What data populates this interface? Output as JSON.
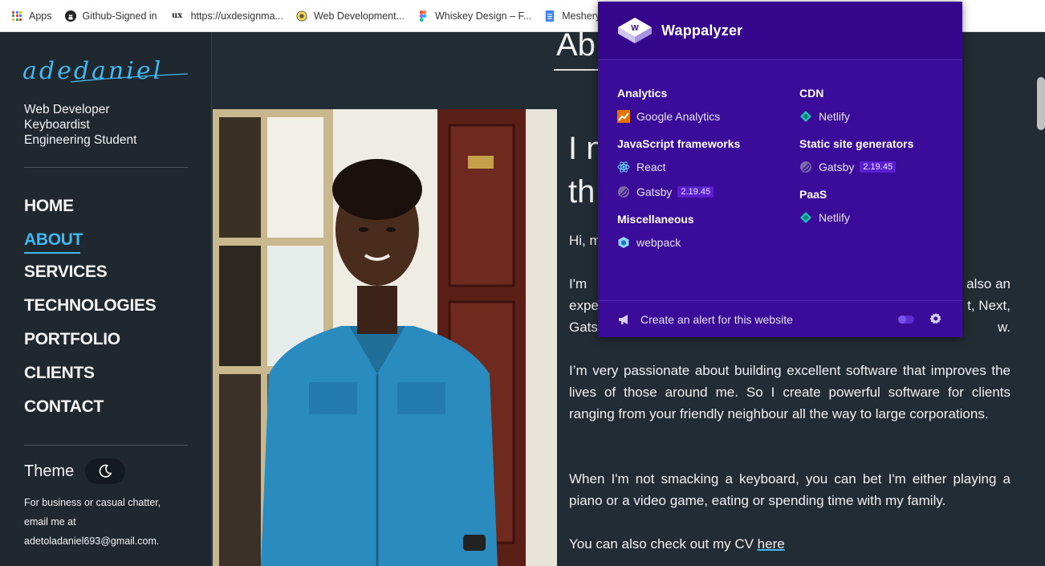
{
  "bookmarks": [
    {
      "icon": "apps-grid-icon",
      "label": "Apps"
    },
    {
      "icon": "github-icon",
      "label": "Github-Signed in"
    },
    {
      "icon": "ux-icon",
      "label": "https://uxdesignma..."
    },
    {
      "icon": "web-dev-icon",
      "label": "Web Development..."
    },
    {
      "icon": "figma-icon",
      "label": "Whiskey Design – F..."
    },
    {
      "icon": "docs-icon",
      "label": "Meshery"
    }
  ],
  "sidebar": {
    "logo_text": "adedaniel",
    "tagline": [
      "Web Developer",
      "Keyboardist",
      "Engineering Student"
    ],
    "nav": [
      {
        "label": "HOME",
        "active": false
      },
      {
        "label": "ABOUT",
        "active": true
      },
      {
        "label": "SERVICES",
        "active": false
      },
      {
        "label": "TECHNOLOGIES",
        "active": false
      },
      {
        "label": "PORTFOLIO",
        "active": false
      },
      {
        "label": "CLIENTS",
        "active": false
      },
      {
        "label": "CONTACT",
        "active": false
      }
    ],
    "theme_label": "Theme",
    "contact_text": "For business or casual chatter, email me at adetoladaniel693@gmail.com."
  },
  "main": {
    "title": "Ab",
    "heading_line1": "I n",
    "heading_line2": "th",
    "para1": "Hi, m",
    "para2_line1_start": "I'm",
    "para2_line1_end": "also an",
    "para2_line2_start": "expe",
    "para2_line2_end": "t, Next,",
    "para2_line3_start": "Gats",
    "para2_line3_end": "w.",
    "para3": "I’m very passionate about building excellent software that improves the lives of those around me. So I create powerful software for clients ranging from your friendly neighbour all the way to large corporations.",
    "para4": "When I'm not smacking a keyboard, you can bet I'm either playing a piano or a video game, eating or spending time with my family.",
    "cv_text": "You can also check out my CV ",
    "cv_link": "here"
  },
  "wappalyzer": {
    "brand": "Wappalyzer",
    "left_column": [
      {
        "category": "Analytics",
        "techs": [
          {
            "icon": "google-analytics-icon",
            "name": "Google Analytics",
            "version": ""
          }
        ]
      },
      {
        "category": "JavaScript frameworks",
        "techs": [
          {
            "icon": "react-icon",
            "name": "React",
            "version": ""
          },
          {
            "icon": "gatsby-icon",
            "name": "Gatsby",
            "version": "2.19.45"
          }
        ]
      },
      {
        "category": "Miscellaneous",
        "techs": [
          {
            "icon": "webpack-icon",
            "name": "webpack",
            "version": ""
          }
        ]
      }
    ],
    "right_column": [
      {
        "category": "CDN",
        "techs": [
          {
            "icon": "netlify-icon",
            "name": "Netlify",
            "version": ""
          }
        ]
      },
      {
        "category": "Static site generators",
        "techs": [
          {
            "icon": "gatsby-icon",
            "name": "Gatsby",
            "version": "2.19.45"
          }
        ]
      },
      {
        "category": "PaaS",
        "techs": [
          {
            "icon": "netlify-icon",
            "name": "Netlify",
            "version": ""
          }
        ]
      }
    ],
    "footer_alert": "Create an alert for this website"
  },
  "colors": {
    "accent": "#41b8ef",
    "wappalyzer_bg": "#3b0c99",
    "page_bg": "#222c35"
  }
}
